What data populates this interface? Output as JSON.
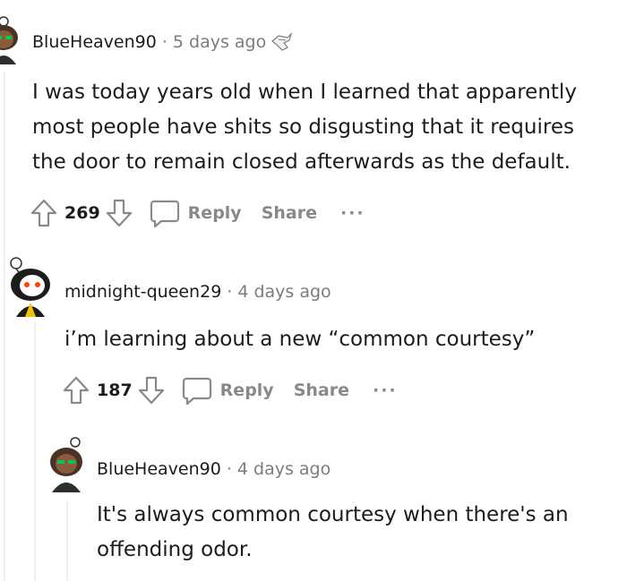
{
  "comments": [
    {
      "username": "BlueHeaven90",
      "separator": "·",
      "time": "5 days ago",
      "award_icon": "award-icon",
      "body_lines": [
        "I was today years old when I learned that apparently",
        "most people have shits so disgusting that it requires",
        "the door to remain closed afterwards as the default."
      ],
      "votes": "269",
      "reply_label": "Reply",
      "share_label": "Share",
      "more_label": "···"
    },
    {
      "username": "midnight-queen29",
      "separator": "·",
      "time": "4 days ago",
      "body_lines": [
        "i’m learning about a new “common courtesy”"
      ],
      "votes": "187",
      "reply_label": "Reply",
      "share_label": "Share",
      "more_label": "···"
    },
    {
      "username": "BlueHeaven90",
      "separator": "·",
      "time": "4 days ago",
      "body_lines": [
        "It's always common courtesy when there's an",
        "offending odor."
      ]
    }
  ],
  "colors": {
    "text": "#1c1c1c",
    "meta": "#7c7c7c",
    "action": "#878a8c",
    "thread_line": "#edeff1"
  }
}
